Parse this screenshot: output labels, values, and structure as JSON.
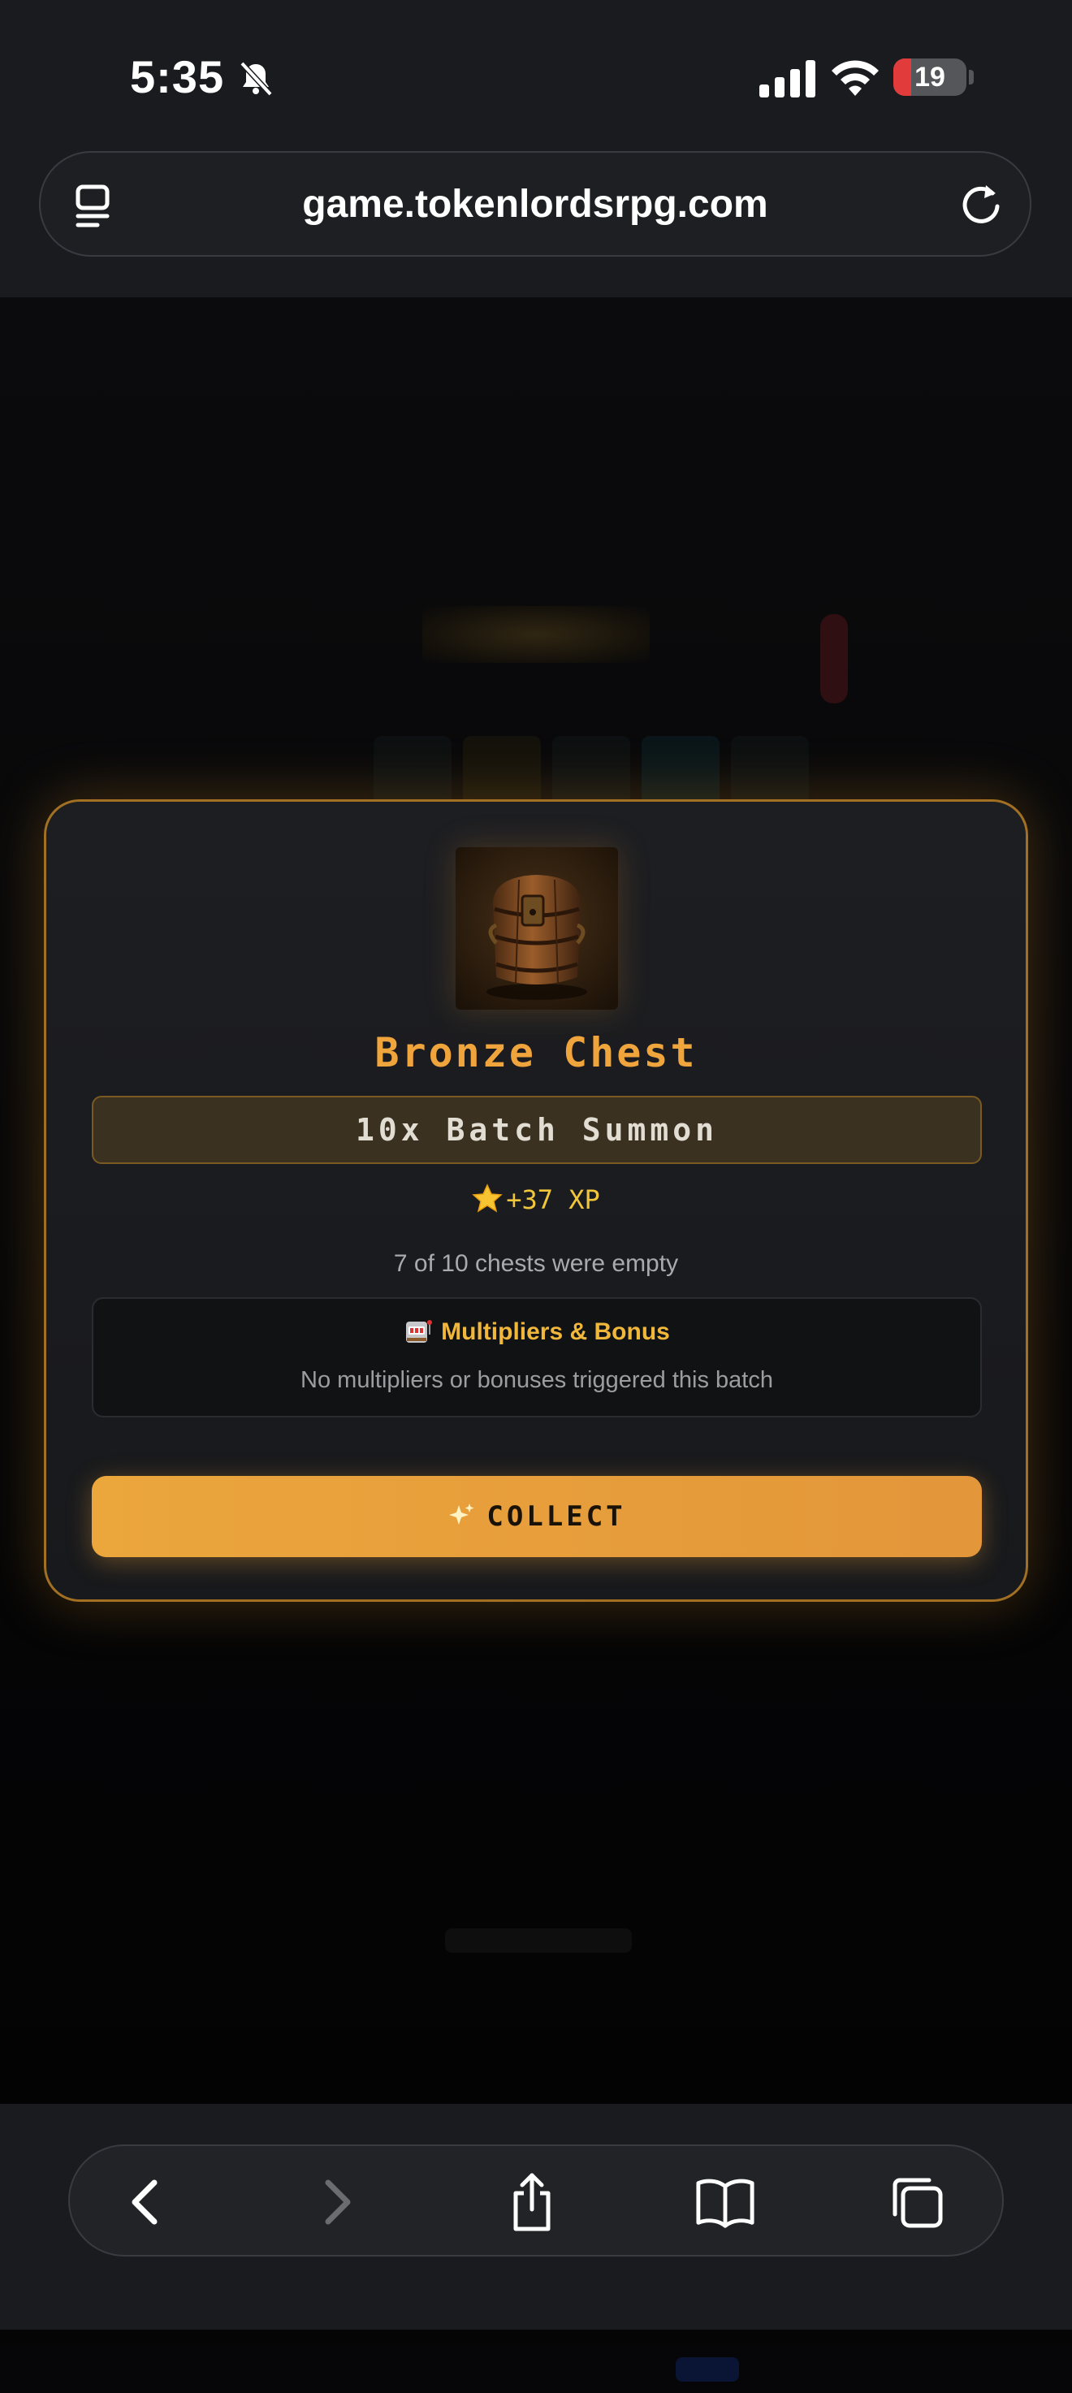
{
  "status_bar": {
    "time": "5:35",
    "battery": "19"
  },
  "browser": {
    "url": "game.tokenlordsrpg.com"
  },
  "modal": {
    "chest_name": "Bronze Chest",
    "batch_label": "10x Batch Summon",
    "xp_reward": "+37 XP",
    "empty_note": "7 of 10 chests were empty",
    "bonus_title": "Multipliers & Bonus",
    "bonus_text": "No multipliers or bonuses triggered this batch",
    "collect_label": "COLLECT"
  },
  "icons": {
    "bell": "bell-slash-icon",
    "signal": "cellular-signal-icon",
    "wifi": "wifi-icon",
    "tabs": "page-menu-icon",
    "reload": "reload-icon",
    "star": "star-icon",
    "slot": "slot-machine-icon",
    "sparkle": "sparkles-icon",
    "back": "back-arrow-icon",
    "forward": "forward-arrow-icon",
    "share": "share-icon",
    "bookmarks": "bookmarks-icon",
    "tab_switcher": "tabs-icon"
  },
  "colors": {
    "accent": "#f0a43c",
    "battery_low": "#e23b3b",
    "xp": "#f1c63a"
  }
}
